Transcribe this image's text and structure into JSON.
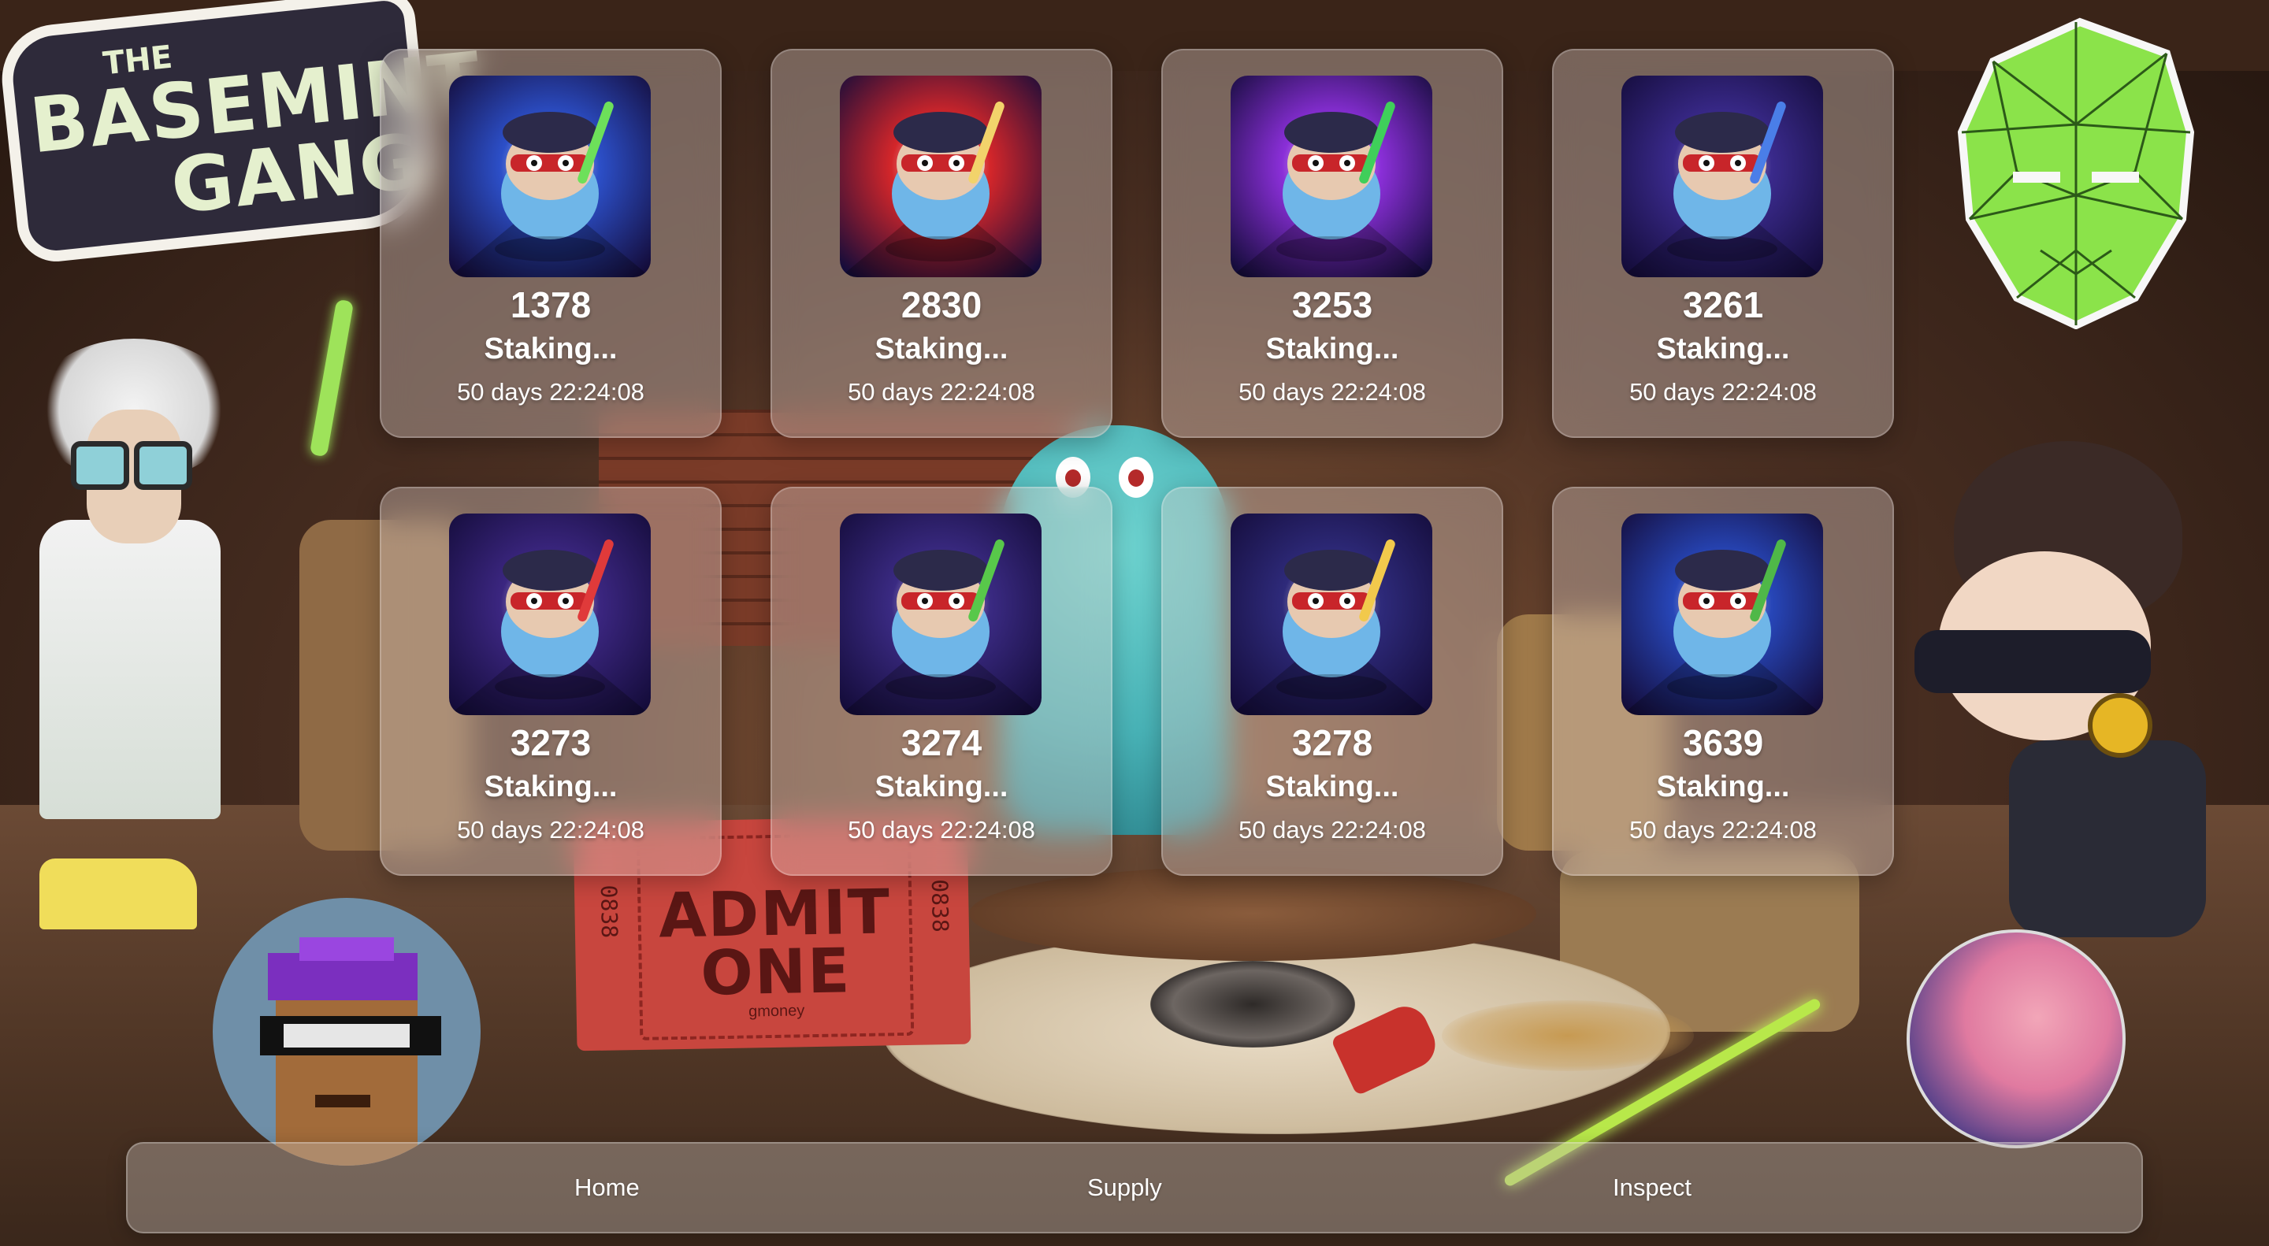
{
  "logo": {
    "small": "THE",
    "line1": "BASEMINT",
    "line2": "GANG"
  },
  "ticket": {
    "line1": "ADMIT",
    "line2": "ONE",
    "serial": "0838",
    "brand": "gmoney"
  },
  "cards": [
    {
      "id": "1378",
      "status": "Staking...",
      "timer": "50 days 22:24:08",
      "art_bg": "#2c4fc8",
      "art_accent": "#6de05a"
    },
    {
      "id": "2830",
      "status": "Staking...",
      "timer": "50 days 22:24:08",
      "art_bg": "#d4262a",
      "art_accent": "#f2d36b"
    },
    {
      "id": "3253",
      "status": "Staking...",
      "timer": "50 days 22:24:08",
      "art_bg": "#8a2fd8",
      "art_accent": "#3fcf5a"
    },
    {
      "id": "3261",
      "status": "Staking...",
      "timer": "50 days 22:24:08",
      "art_bg": "#3a2a8c",
      "art_accent": "#4a7ee8"
    },
    {
      "id": "3273",
      "status": "Staking...",
      "timer": "50 days 22:24:08",
      "art_bg": "#3b2680",
      "art_accent": "#e03a3a"
    },
    {
      "id": "3274",
      "status": "Staking...",
      "timer": "50 days 22:24:08",
      "art_bg": "#3a2a82",
      "art_accent": "#58c84a"
    },
    {
      "id": "3278",
      "status": "Staking...",
      "timer": "50 days 22:24:08",
      "art_bg": "#2e2a7a",
      "art_accent": "#f2c94c"
    },
    {
      "id": "3639",
      "status": "Staking...",
      "timer": "50 days 22:24:08",
      "art_bg": "#2746b8",
      "art_accent": "#4fb848"
    }
  ],
  "nav": {
    "items": [
      {
        "label": "Home"
      },
      {
        "label": "Supply"
      },
      {
        "label": "Inspect"
      }
    ]
  }
}
